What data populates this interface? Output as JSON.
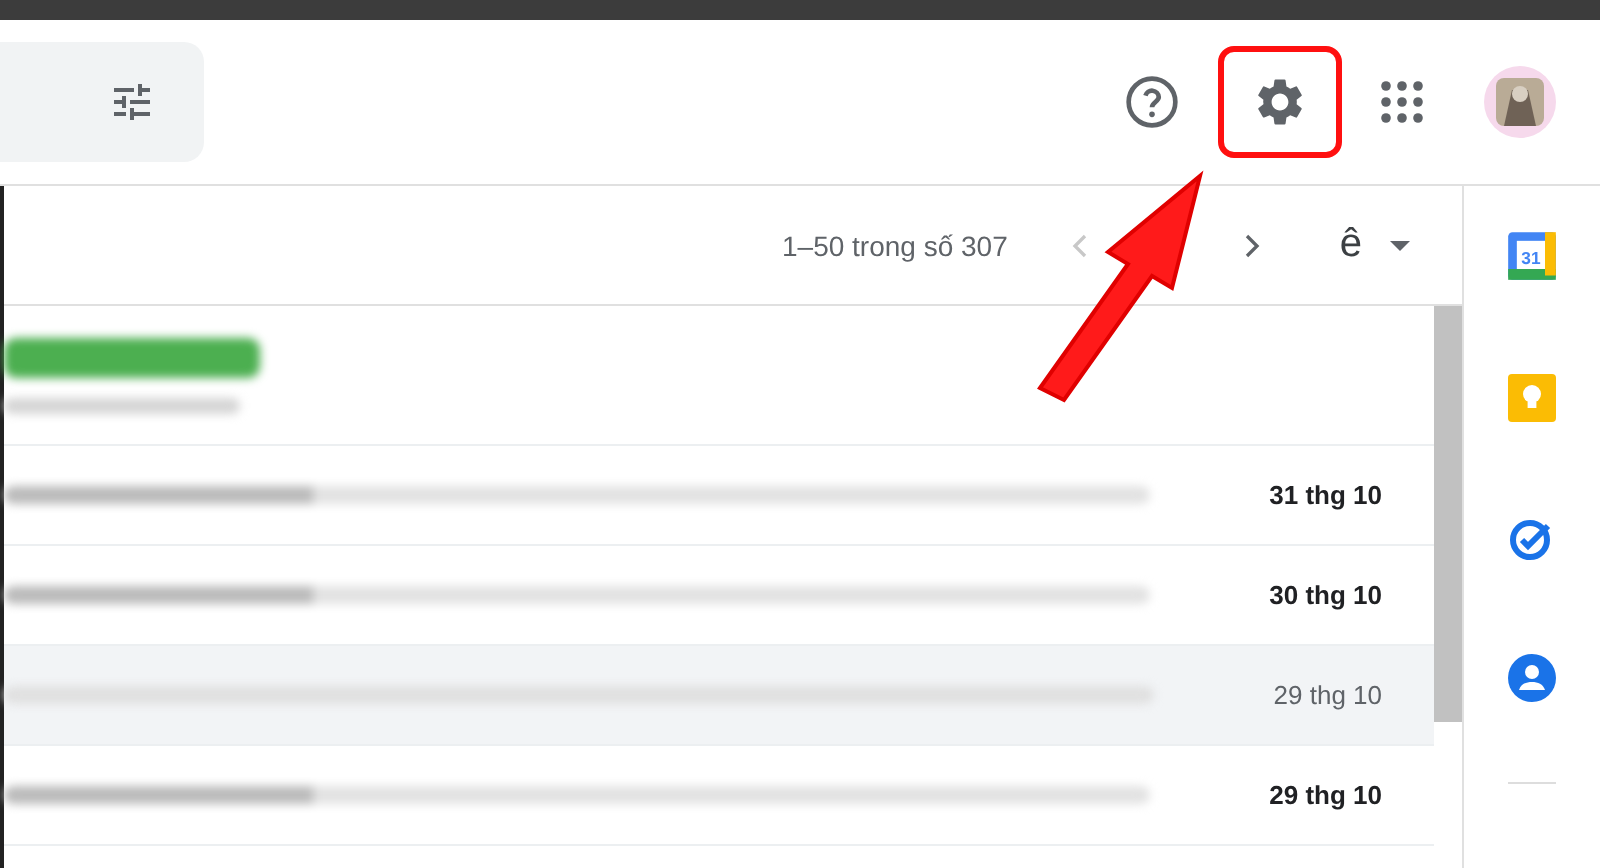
{
  "toolbar": {
    "page_range": "1–50 trong số 307",
    "input_tool_label": "ê"
  },
  "annotation": {
    "highlight_settings": true
  },
  "emails": [
    {
      "kind": "labelled",
      "selected": false
    },
    {
      "kind": "plain",
      "unread": true,
      "selected": false,
      "date": "31 thg 10"
    },
    {
      "kind": "plain",
      "unread": true,
      "selected": false,
      "date": "30 thg 10"
    },
    {
      "kind": "plain",
      "unread": false,
      "selected": true,
      "date": "29 thg 10"
    },
    {
      "kind": "plain",
      "unread": true,
      "selected": false,
      "date": "29 thg 10"
    }
  ],
  "side_panel": [
    {
      "kind": "calendar",
      "label": "31"
    },
    {
      "kind": "keep"
    },
    {
      "kind": "tasks"
    },
    {
      "kind": "contacts"
    }
  ]
}
